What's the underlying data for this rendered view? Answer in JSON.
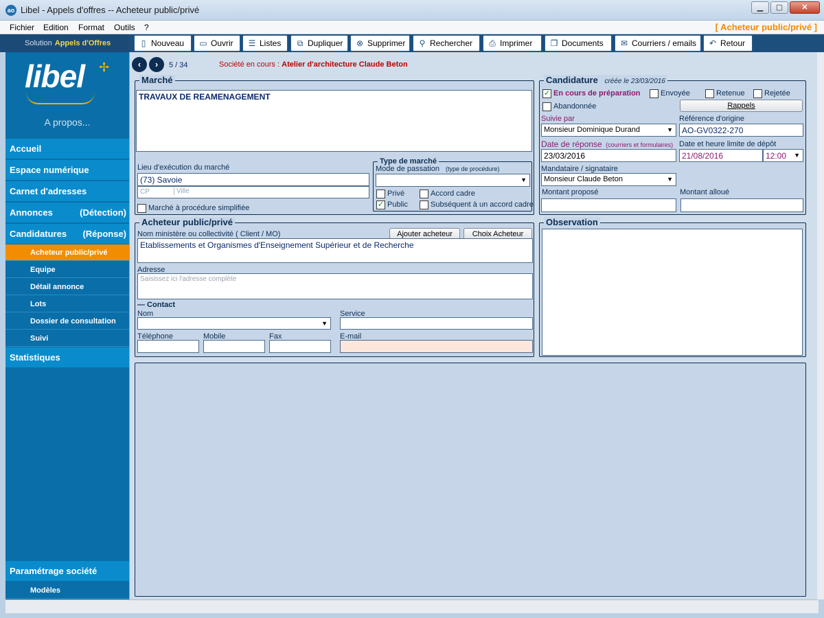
{
  "window": {
    "title": "Libel - Appels d'offres -- Acheteur public/privé",
    "app_icon": "ao",
    "min": "▁",
    "max": "▢",
    "close": "✕"
  },
  "menu": {
    "items": [
      "Fichier",
      "Edition",
      "Format",
      "Outils",
      "?"
    ],
    "context": "[ Acheteur public/privé ]"
  },
  "toolbar": {
    "solution_prefix": "Solution",
    "solution_name": "Appels d'Offres",
    "buttons": [
      {
        "label": "Nouveau",
        "icon": "new-file-icon"
      },
      {
        "label": "Ouvrir",
        "icon": "folder-open-icon"
      },
      {
        "label": "Listes",
        "icon": "list-icon"
      },
      {
        "label": "Dupliquer",
        "icon": "duplicate-icon"
      },
      {
        "label": "Supprimer",
        "icon": "delete-icon"
      },
      {
        "label": "Rechercher",
        "icon": "search-icon"
      },
      {
        "label": "Imprimer",
        "icon": "printer-icon"
      },
      {
        "label": "Documents",
        "icon": "documents-icon"
      },
      {
        "label": "Courriers / emails",
        "icon": "mail-icon"
      },
      {
        "label": "Retour",
        "icon": "undo-icon"
      }
    ]
  },
  "sidebar": {
    "logo": "libel",
    "apropos": "A propos...",
    "main_items": [
      {
        "label": "Accueil",
        "right": ""
      },
      {
        "label": "Espace numérique",
        "right": ""
      },
      {
        "label": "Carnet d'adresses",
        "right": ""
      },
      {
        "label": "Annonces",
        "right": "(Détection)"
      },
      {
        "label": "Candidatures",
        "right": "(Réponse)"
      }
    ],
    "sub_items": [
      "Acheteur public/privé",
      "Equipe",
      "Détail annonce",
      "Lots",
      "Dossier de consultation",
      "Suivi"
    ],
    "stats": "Statistiques",
    "settings": "Paramétrage société",
    "models": "Modèles"
  },
  "nav": {
    "prev": "‹",
    "next": "›",
    "counter": "5 / 34",
    "societe_label": "Société en cours :",
    "societe_name": "Atelier d'architecture Claude Beton"
  },
  "marche": {
    "title": "Marché",
    "text": "TRAVAUX DE REAMENAGEMENT",
    "lieu_label": "Lieu d'exécution du marché",
    "lieu_value": "(73) Savoie",
    "cp_placeholder": "CP",
    "ville_placeholder": "Ville",
    "simplifiee_label": "Marché à procédure simplifiée",
    "type_title": "Type de marché",
    "mode_label": "Mode de passation",
    "mode_hint": "(type de procédure)",
    "prive": "Privé",
    "public": "Public",
    "accord": "Accord cadre",
    "subsequent": "Subséquent à un accord cadre"
  },
  "candidature": {
    "title": "Candidature",
    "created": "créée le 23/03/2016",
    "en_cours": "En cours de préparation",
    "envoyee": "Envoyée",
    "retenue": "Retenue",
    "rejetee": "Rejetée",
    "abandonnee": "Abandonnée",
    "rappels": "Rappels",
    "suivie_label": "Suivie par",
    "suivie_value": "Monsieur Dominique Durand",
    "ref_label": "Référence d'origine",
    "ref_value": "AO-GV0322-270",
    "date_rep_label": "Date de réponse",
    "date_rep_hint": "(courriers et formulaires)",
    "date_rep_value": "23/03/2016",
    "date_limite_label": "Date et heure limite de dépôt",
    "date_limite_value": "21/08/2016",
    "heure_value": "12:00",
    "mandataire_label": "Mandataire / signataire",
    "mandataire_value": "Monsieur Claude Beton",
    "montant_propose_label": "Montant proposé",
    "montant_alloue_label": "Montant alloué"
  },
  "acheteur": {
    "title": "Acheteur public/privé",
    "nom_label": "Nom ministère ou collectivité ( Client / MO)",
    "ajouter": "Ajouter acheteur",
    "choix": "Choix Acheteur",
    "nom_value": "Etablissements et Organismes d'Enseignement Supérieur et de Recherche",
    "adresse_label": "Adresse",
    "adresse_placeholder": "Saisissez ici l'adresse complète",
    "contact_title": "— Contact",
    "nom": "Nom",
    "service": "Service",
    "telephone": "Téléphone",
    "mobile": "Mobile",
    "fax": "Fax",
    "email": "E-mail"
  },
  "observation": {
    "title": "Observation"
  }
}
